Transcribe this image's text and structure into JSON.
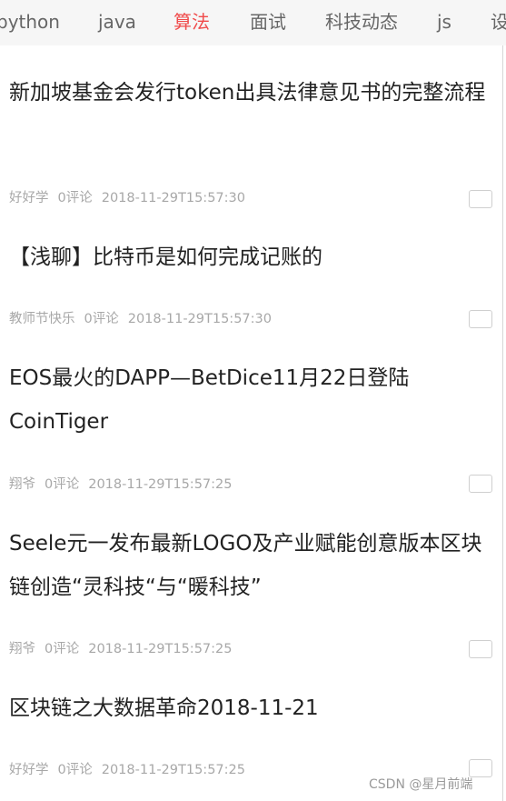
{
  "tabs": [
    {
      "label": "python"
    },
    {
      "label": "java"
    },
    {
      "label": "算法"
    },
    {
      "label": "面试"
    },
    {
      "label": "科技动态"
    },
    {
      "label": "js"
    },
    {
      "label": "设"
    }
  ],
  "active_tab": "算法",
  "articles": [
    {
      "title": "新加坡基金会发行token出具法律意见书的完整流程",
      "author": "好好学",
      "comments": "0评论",
      "time": "2018-11-29T15:57:30"
    },
    {
      "title": "【浅聊】比特币是如何完成记账的",
      "author": "教师节快乐",
      "comments": "0评论",
      "time": "2018-11-29T15:57:30"
    },
    {
      "title": "EOS最火的DAPP—BetDice11月22日登陆CoinTiger",
      "author": "翔爷",
      "comments": "0评论",
      "time": "2018-11-29T15:57:25"
    },
    {
      "title": "Seele元一发布最新LOGO及产业赋能创意版本区块链创造“灵科技“与“暖科技”",
      "author": "翔爷",
      "comments": "0评论",
      "time": "2018-11-29T15:57:25"
    },
    {
      "title": "区块链之大数据革命2018-11-21",
      "author": "好好学",
      "comments": "0评论",
      "time": "2018-11-29T15:57:25"
    }
  ],
  "watermark": "CSDN @星月前端",
  "colors": {
    "active_tab": "#f04b4b",
    "tab_text": "#666666",
    "tab_bar_bg": "#f6f6f6",
    "meta_text": "#a8a8a8"
  }
}
